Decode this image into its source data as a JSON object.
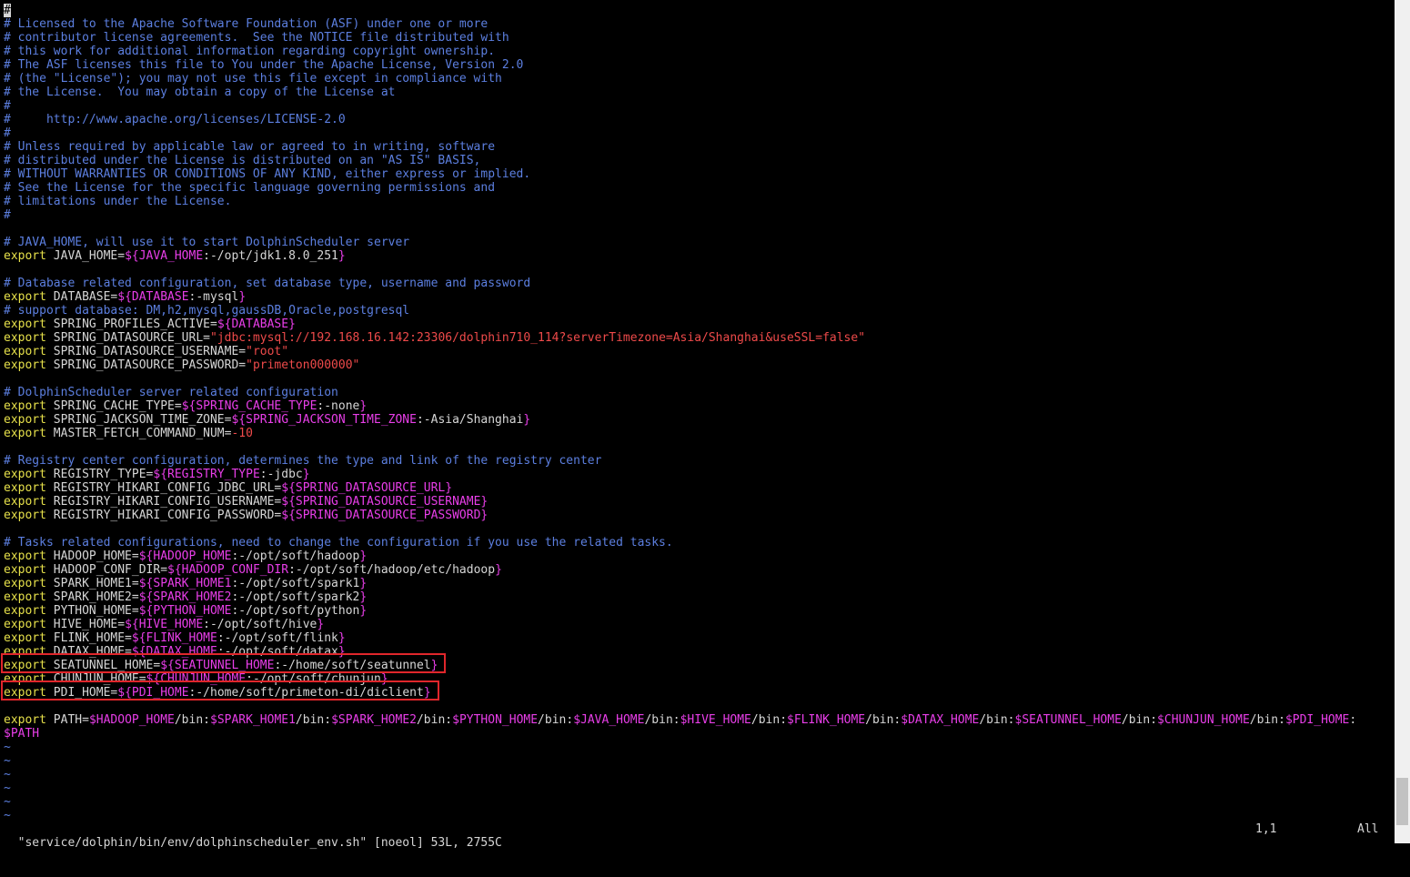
{
  "editor": {
    "lines": [
      [
        {
          "c": "cursor",
          "t": "#"
        }
      ],
      [
        {
          "c": "comment",
          "t": "# Licensed to the Apache Software Foundation (ASF) under one or more"
        }
      ],
      [
        {
          "c": "comment",
          "t": "# contributor license agreements.  See the NOTICE file distributed with"
        }
      ],
      [
        {
          "c": "comment",
          "t": "# this work for additional information regarding copyright ownership."
        }
      ],
      [
        {
          "c": "comment",
          "t": "# The ASF licenses this file to You under the Apache License, Version 2.0"
        }
      ],
      [
        {
          "c": "comment",
          "t": "# (the \"License\"); you may not use this file except in compliance with"
        }
      ],
      [
        {
          "c": "comment",
          "t": "# the License.  You may obtain a copy of the License at"
        }
      ],
      [
        {
          "c": "comment",
          "t": "#"
        }
      ],
      [
        {
          "c": "comment",
          "t": "#     http://www.apache.org/licenses/LICENSE-2.0"
        }
      ],
      [
        {
          "c": "comment",
          "t": "#"
        }
      ],
      [
        {
          "c": "comment",
          "t": "# Unless required by applicable law or agreed to in writing, software"
        }
      ],
      [
        {
          "c": "comment",
          "t": "# distributed under the License is distributed on an \"AS IS\" BASIS,"
        }
      ],
      [
        {
          "c": "comment",
          "t": "# WITHOUT WARRANTIES OR CONDITIONS OF ANY KIND, either express or implied."
        }
      ],
      [
        {
          "c": "comment",
          "t": "# See the License for the specific language governing permissions and"
        }
      ],
      [
        {
          "c": "comment",
          "t": "# limitations under the License."
        }
      ],
      [
        {
          "c": "comment",
          "t": "#"
        }
      ],
      [],
      [
        {
          "c": "comment",
          "t": "# JAVA_HOME, will use it to start DolphinScheduler server"
        }
      ],
      [
        {
          "c": "kw",
          "t": "export"
        },
        {
          "c": "text",
          "t": " JAVA_HOME="
        },
        {
          "c": "var",
          "t": "${JAVA_HOME"
        },
        {
          "c": "text",
          "t": ":-/opt/jdk1.8.0_251"
        },
        {
          "c": "var",
          "t": "}"
        }
      ],
      [],
      [
        {
          "c": "comment",
          "t": "# Database related configuration, set database type, username and password"
        }
      ],
      [
        {
          "c": "kw",
          "t": "export"
        },
        {
          "c": "text",
          "t": " DATABASE="
        },
        {
          "c": "var",
          "t": "${DATABASE"
        },
        {
          "c": "text",
          "t": ":-mysql"
        },
        {
          "c": "var",
          "t": "}"
        }
      ],
      [
        {
          "c": "comment",
          "t": "# support database: DM,h2,mysql,gaussDB,Oracle,postgresql"
        }
      ],
      [
        {
          "c": "kw",
          "t": "export"
        },
        {
          "c": "text",
          "t": " SPRING_PROFILES_ACTIVE="
        },
        {
          "c": "var",
          "t": "${DATABASE}"
        }
      ],
      [
        {
          "c": "kw",
          "t": "export"
        },
        {
          "c": "text",
          "t": " SPRING_DATASOURCE_URL="
        },
        {
          "c": "str",
          "t": "\"jdbc:mysql://192.168.16.142:23306/dolphin710_114?serverTimezone=Asia/Shanghai&useSSL=false\""
        }
      ],
      [
        {
          "c": "kw",
          "t": "export"
        },
        {
          "c": "text",
          "t": " SPRING_DATASOURCE_USERNAME="
        },
        {
          "c": "str",
          "t": "\"root\""
        }
      ],
      [
        {
          "c": "kw",
          "t": "export"
        },
        {
          "c": "text",
          "t": " SPRING_DATASOURCE_PASSWORD="
        },
        {
          "c": "str",
          "t": "\"primeton000000\""
        }
      ],
      [],
      [
        {
          "c": "comment",
          "t": "# DolphinScheduler server related configuration"
        }
      ],
      [
        {
          "c": "kw",
          "t": "export"
        },
        {
          "c": "text",
          "t": " SPRING_CACHE_TYPE="
        },
        {
          "c": "var",
          "t": "${SPRING_CACHE_TYPE"
        },
        {
          "c": "text",
          "t": ":-none"
        },
        {
          "c": "var",
          "t": "}"
        }
      ],
      [
        {
          "c": "kw",
          "t": "export"
        },
        {
          "c": "text",
          "t": " SPRING_JACKSON_TIME_ZONE="
        },
        {
          "c": "var",
          "t": "${SPRING_JACKSON_TIME_ZONE"
        },
        {
          "c": "text",
          "t": ":-Asia/Shanghai"
        },
        {
          "c": "var",
          "t": "}"
        }
      ],
      [
        {
          "c": "kw",
          "t": "export"
        },
        {
          "c": "text",
          "t": " MASTER_FETCH_COMMAND_NUM="
        },
        {
          "c": "num",
          "t": "-10"
        }
      ],
      [],
      [
        {
          "c": "comment",
          "t": "# Registry center configuration, determines the type and link of the registry center"
        }
      ],
      [
        {
          "c": "kw",
          "t": "export"
        },
        {
          "c": "text",
          "t": " REGISTRY_TYPE="
        },
        {
          "c": "var",
          "t": "${REGISTRY_TYPE"
        },
        {
          "c": "text",
          "t": ":-jdbc"
        },
        {
          "c": "var",
          "t": "}"
        }
      ],
      [
        {
          "c": "kw",
          "t": "export"
        },
        {
          "c": "text",
          "t": " REGISTRY_HIKARI_CONFIG_JDBC_URL="
        },
        {
          "c": "var",
          "t": "${SPRING_DATASOURCE_URL}"
        }
      ],
      [
        {
          "c": "kw",
          "t": "export"
        },
        {
          "c": "text",
          "t": " REGISTRY_HIKARI_CONFIG_USERNAME="
        },
        {
          "c": "var",
          "t": "${SPRING_DATASOURCE_USERNAME}"
        }
      ],
      [
        {
          "c": "kw",
          "t": "export"
        },
        {
          "c": "text",
          "t": " REGISTRY_HIKARI_CONFIG_PASSWORD="
        },
        {
          "c": "var",
          "t": "${SPRING_DATASOURCE_PASSWORD}"
        }
      ],
      [],
      [
        {
          "c": "comment",
          "t": "# Tasks related configurations, need to change the configuration if you use the related tasks."
        }
      ],
      [
        {
          "c": "kw",
          "t": "export"
        },
        {
          "c": "text",
          "t": " HADOOP_HOME="
        },
        {
          "c": "var",
          "t": "${HADOOP_HOME"
        },
        {
          "c": "text",
          "t": ":-/opt/soft/hadoop"
        },
        {
          "c": "var",
          "t": "}"
        }
      ],
      [
        {
          "c": "kw",
          "t": "export"
        },
        {
          "c": "text",
          "t": " HADOOP_CONF_DIR="
        },
        {
          "c": "var",
          "t": "${HADOOP_CONF_DIR"
        },
        {
          "c": "text",
          "t": ":-/opt/soft/hadoop/etc/hadoop"
        },
        {
          "c": "var",
          "t": "}"
        }
      ],
      [
        {
          "c": "kw",
          "t": "export"
        },
        {
          "c": "text",
          "t": " SPARK_HOME1="
        },
        {
          "c": "var",
          "t": "${SPARK_HOME1"
        },
        {
          "c": "text",
          "t": ":-/opt/soft/spark1"
        },
        {
          "c": "var",
          "t": "}"
        }
      ],
      [
        {
          "c": "kw",
          "t": "export"
        },
        {
          "c": "text",
          "t": " SPARK_HOME2="
        },
        {
          "c": "var",
          "t": "${SPARK_HOME2"
        },
        {
          "c": "text",
          "t": ":-/opt/soft/spark2"
        },
        {
          "c": "var",
          "t": "}"
        }
      ],
      [
        {
          "c": "kw",
          "t": "export"
        },
        {
          "c": "text",
          "t": " PYTHON_HOME="
        },
        {
          "c": "var",
          "t": "${PYTHON_HOME"
        },
        {
          "c": "text",
          "t": ":-/opt/soft/python"
        },
        {
          "c": "var",
          "t": "}"
        }
      ],
      [
        {
          "c": "kw",
          "t": "export"
        },
        {
          "c": "text",
          "t": " HIVE_HOME="
        },
        {
          "c": "var",
          "t": "${HIVE_HOME"
        },
        {
          "c": "text",
          "t": ":-/opt/soft/hive"
        },
        {
          "c": "var",
          "t": "}"
        }
      ],
      [
        {
          "c": "kw",
          "t": "export"
        },
        {
          "c": "text",
          "t": " FLINK_HOME="
        },
        {
          "c": "var",
          "t": "${FLINK_HOME"
        },
        {
          "c": "text",
          "t": ":-/opt/soft/flink"
        },
        {
          "c": "var",
          "t": "}"
        }
      ],
      [
        {
          "c": "kw",
          "t": "export"
        },
        {
          "c": "text",
          "t": " DATAX_HOME="
        },
        {
          "c": "var",
          "t": "${DATAX_HOME"
        },
        {
          "c": "text",
          "t": ":-/opt/soft/datax"
        },
        {
          "c": "var",
          "t": "}"
        }
      ],
      [
        {
          "c": "kw",
          "t": "export"
        },
        {
          "c": "text",
          "t": " SEATUNNEL_HOME="
        },
        {
          "c": "var",
          "t": "${SEATUNNEL_HOME"
        },
        {
          "c": "text",
          "t": ":-/home/soft/seatunnel"
        },
        {
          "c": "var",
          "t": "}"
        }
      ],
      [
        {
          "c": "kw",
          "t": "export"
        },
        {
          "c": "text",
          "t": " CHUNJUN_HOME="
        },
        {
          "c": "var",
          "t": "${CHUNJUN_HOME"
        },
        {
          "c": "text",
          "t": ":-/opt/soft/chunjun"
        },
        {
          "c": "var",
          "t": "}"
        }
      ],
      [
        {
          "c": "kw",
          "t": "export"
        },
        {
          "c": "text",
          "t": " PDI_HOME="
        },
        {
          "c": "var",
          "t": "${PDI_HOME"
        },
        {
          "c": "text",
          "t": ":-/home/soft/primeton-di/diclient"
        },
        {
          "c": "var",
          "t": "}"
        }
      ],
      [],
      [
        {
          "c": "kw",
          "t": "export"
        },
        {
          "c": "text",
          "t": " PATH="
        },
        {
          "c": "var",
          "t": "$HADOOP_HOME"
        },
        {
          "c": "text",
          "t": "/bin:"
        },
        {
          "c": "var",
          "t": "$SPARK_HOME1"
        },
        {
          "c": "text",
          "t": "/bin:"
        },
        {
          "c": "var",
          "t": "$SPARK_HOME2"
        },
        {
          "c": "text",
          "t": "/bin:"
        },
        {
          "c": "var",
          "t": "$PYTHON_HOME"
        },
        {
          "c": "text",
          "t": "/bin:"
        },
        {
          "c": "var",
          "t": "$JAVA_HOME"
        },
        {
          "c": "text",
          "t": "/bin:"
        },
        {
          "c": "var",
          "t": "$HIVE_HOME"
        },
        {
          "c": "text",
          "t": "/bin:"
        },
        {
          "c": "var",
          "t": "$FLINK_HOME"
        },
        {
          "c": "text",
          "t": "/bin:"
        },
        {
          "c": "var",
          "t": "$DATAX_HOME"
        },
        {
          "c": "text",
          "t": "/bin:"
        },
        {
          "c": "var",
          "t": "$SEATUNNEL_HOME"
        },
        {
          "c": "text",
          "t": "/bin:"
        },
        {
          "c": "var",
          "t": "$CHUNJUN_HOME"
        },
        {
          "c": "text",
          "t": "/bin:"
        },
        {
          "c": "var",
          "t": "$PDI_HOME"
        },
        {
          "c": "text",
          "t": ":"
        }
      ],
      [
        {
          "c": "var",
          "t": "$PATH"
        }
      ],
      [
        {
          "c": "tilde",
          "t": "~"
        }
      ],
      [
        {
          "c": "tilde",
          "t": "~"
        }
      ],
      [
        {
          "c": "tilde",
          "t": "~"
        }
      ],
      [
        {
          "c": "tilde",
          "t": "~"
        }
      ],
      [
        {
          "c": "tilde",
          "t": "~"
        }
      ],
      [
        {
          "c": "tilde",
          "t": "~"
        }
      ]
    ],
    "highlighted_lines": [
      48,
      50
    ]
  },
  "status_bar": {
    "file_info": "\"service/dolphin/bin/env/dolphinscheduler_env.sh\" [noeol] 53L, 2755C",
    "cursor_position": "1,1",
    "scroll_position": "All"
  },
  "colors": {
    "background": "#000000",
    "comment": "#5c7fe0",
    "keyword": "#e6e04a",
    "variable": "#e83ee8",
    "string": "#ee4a4a",
    "text": "#d6d6d6",
    "highlight_box": "#e0262b"
  }
}
